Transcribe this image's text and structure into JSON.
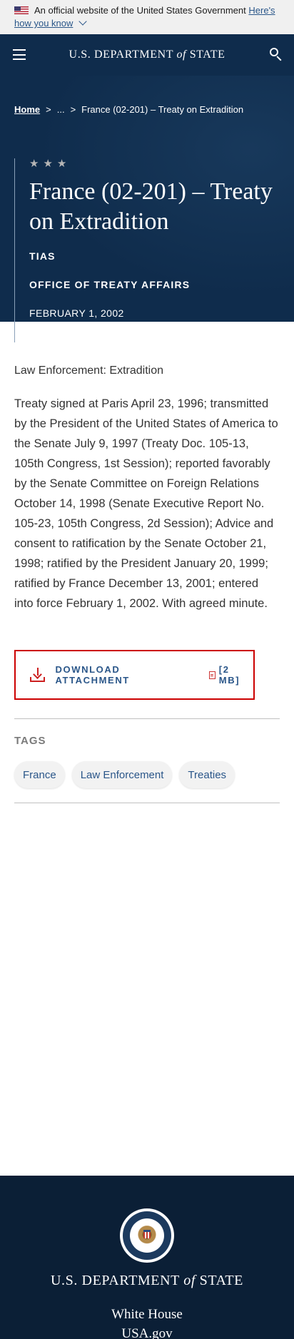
{
  "gov_banner": {
    "text": "An official website of the United States Government",
    "link_text_1": "Here's",
    "link_text_2": "how you know"
  },
  "header": {
    "title_pre": "U.S. DEPARTMENT",
    "title_of": "of",
    "title_post": "STATE"
  },
  "breadcrumb": {
    "home": "Home",
    "sep1": ">",
    "ellipsis": "...",
    "sep2": ">",
    "current": "France (02-201) – Treaty on Extradition"
  },
  "hero": {
    "stars": "★★★",
    "title": "France (02-201) – Treaty on Extradition",
    "kicker": "TIAS",
    "office": "OFFICE OF TREATY AFFAIRS",
    "date": "FEBRUARY 1, 2002"
  },
  "main": {
    "category": "Law Enforcement: Extradition",
    "body": "Treaty signed at Paris April 23, 1996; transmitted by the President of the United States of America to the Senate July 9, 1997 (Treaty Doc. 105-13, 105th Congress, 1st Session); reported favorably by the Senate Committee on Foreign Relations October 14, 1998 (Senate Executive Report No. 105-23, 105th Congress, 2d Session); Advice and consent to ratification by the Senate October 21, 1998; ratified by the President January 20, 1999; ratified by France December 13, 2001; entered into force February 1, 2002. With agreed minute.",
    "download_label": "DOWNLOAD ATTACHMENT",
    "download_size": "[2 MB]",
    "tags_label": "TAGS",
    "tags": [
      "France",
      "Law Enforcement",
      "Treaties"
    ]
  },
  "footer": {
    "title_pre": "U.S. DEPARTMENT",
    "title_of": "of",
    "title_post": "STATE",
    "links": [
      "White House",
      "USA.gov"
    ]
  },
  "colors": {
    "navy": "#0f2c4c",
    "footer_navy": "#0b1f36",
    "link_blue": "#2a5689",
    "alert_red": "#cc0000"
  }
}
